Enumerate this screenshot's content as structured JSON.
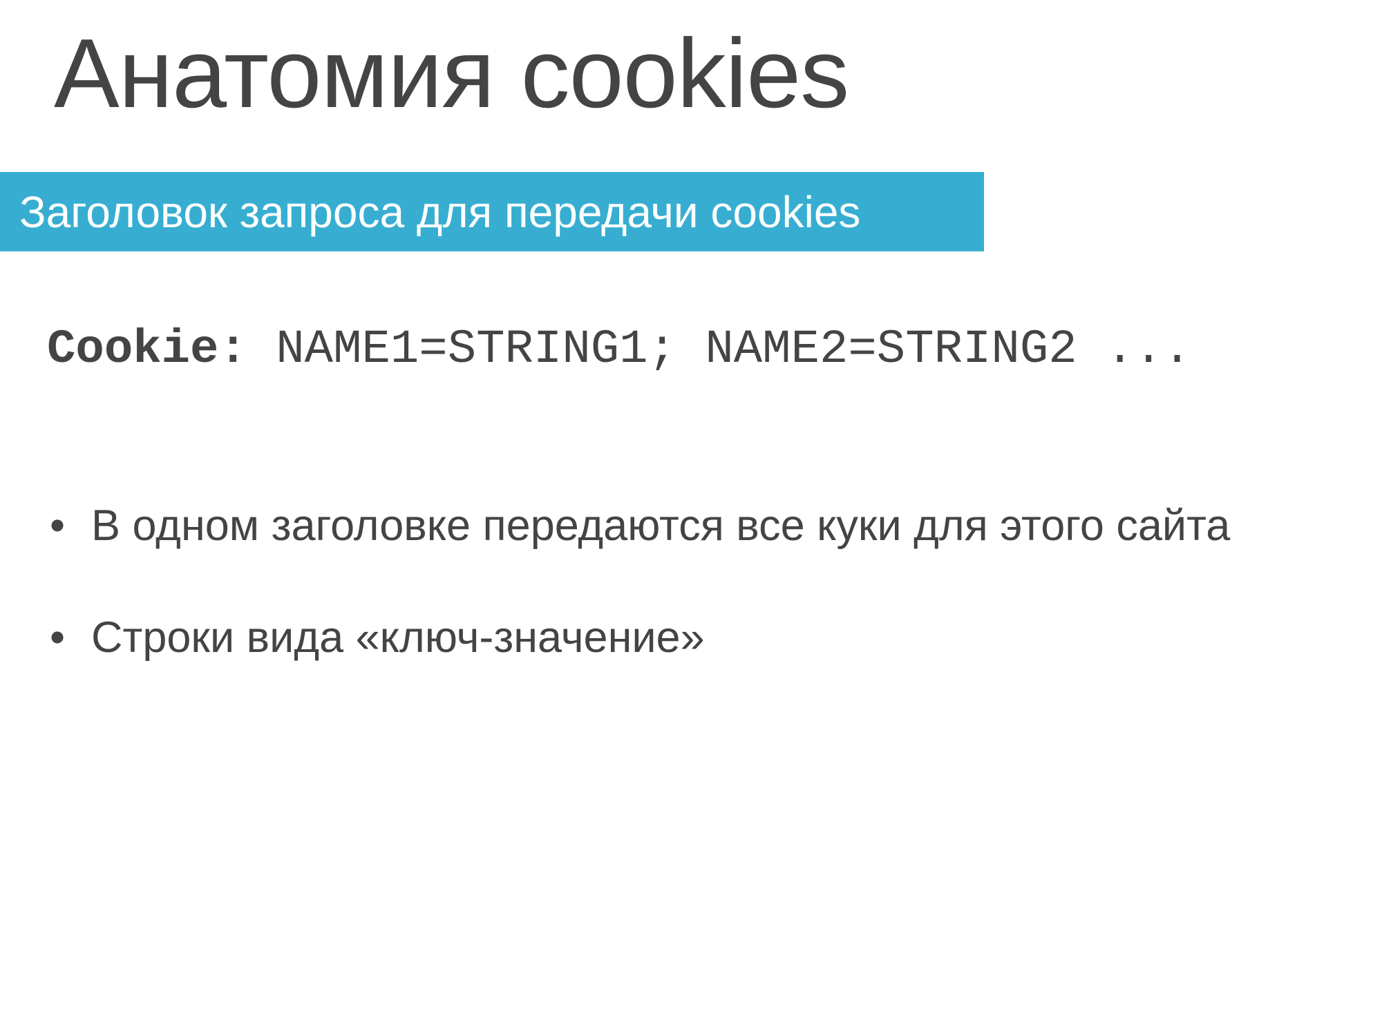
{
  "slide": {
    "title": "Анатомия cookies",
    "banner": "Заголовок запроса для передачи cookies",
    "code": {
      "key": "Cookie:",
      "value": " NAME1=STRING1; NAME2=STRING2 ..."
    },
    "bullet_marker": "•",
    "bullets": [
      {
        "text": "В одном заголовке передаются все куки для этого сайта"
      },
      {
        "text": "Строки вида «ключ-значение»"
      }
    ]
  }
}
